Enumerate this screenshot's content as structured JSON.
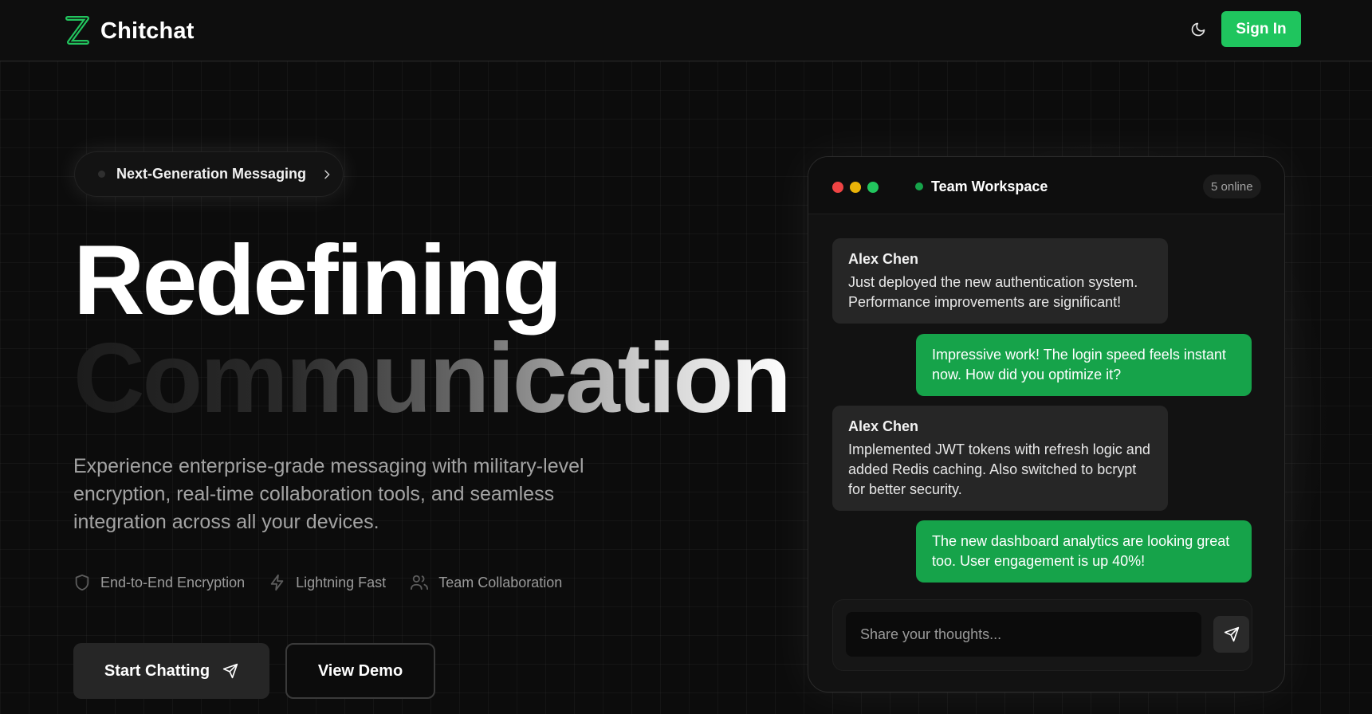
{
  "brand": {
    "name": "Chitchat",
    "color": "#22c55e"
  },
  "header": {
    "theme_icon": "moon-icon",
    "signin_label": "Sign In"
  },
  "hero": {
    "badge": "Next-Generation Messaging",
    "title_line1": "Redefining",
    "title_line2": "Communication",
    "description": "Experience enterprise-grade messaging with military-level encryption, real-time collaboration tools, and seamless integration across all your devices.",
    "features": [
      {
        "icon": "shield-icon",
        "label": "End-to-End Encryption"
      },
      {
        "icon": "lightning-icon",
        "label": "Lightning Fast"
      },
      {
        "icon": "users-icon",
        "label": "Team Collaboration"
      }
    ],
    "primary_cta": "Start Chatting",
    "secondary_cta": "View Demo"
  },
  "chat": {
    "title": "Team Workspace",
    "online": "5 online",
    "messages": [
      {
        "author": "Alex Chen",
        "text": "Just deployed the new authentication system. Performance improvements are significant!"
      },
      {
        "text": "Impressive work! The login speed feels instant now. How did you optimize it?"
      },
      {
        "author": "Alex Chen",
        "text": "Implemented JWT tokens with refresh logic and added Redis caching. Also switched to bcrypt for better security."
      },
      {
        "text": "The new dashboard analytics are looking great too. User engagement is up 40%!"
      }
    ],
    "input_placeholder": "Share your thoughts..."
  },
  "colors": {
    "background": "#0c0c0c",
    "accent": "#22c55e",
    "outgoing_bubble": "#16a34a",
    "incoming_bubble": "#262626",
    "traffic_lights": [
      "#ef4444",
      "#eab308",
      "#22c55e"
    ]
  }
}
